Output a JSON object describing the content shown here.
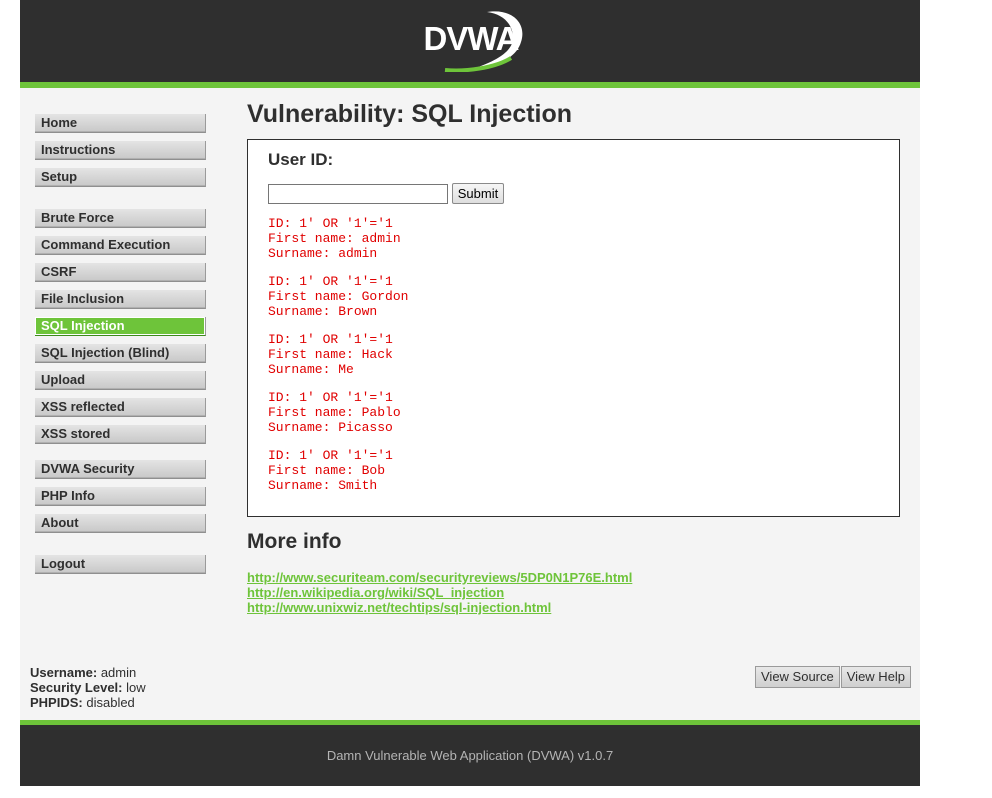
{
  "header": {
    "logo_text": "DVWA"
  },
  "menu": {
    "group1": [
      "Home",
      "Instructions",
      "Setup"
    ],
    "group2": [
      "Brute Force",
      "Command Execution",
      "CSRF",
      "File Inclusion",
      "SQL Injection",
      "SQL Injection (Blind)",
      "Upload",
      "XSS reflected",
      "XSS stored"
    ],
    "group3": [
      "DVWA Security",
      "PHP Info",
      "About"
    ],
    "group4": [
      "Logout"
    ],
    "selected": "SQL Injection"
  },
  "main": {
    "title": "Vulnerability: SQL Injection",
    "form": {
      "label": "User ID:",
      "input_value": "",
      "submit_label": "Submit"
    },
    "results": [
      {
        "id": "ID: 1' OR '1'='1",
        "first": "First name: admin",
        "surname": "Surname: admin"
      },
      {
        "id": "ID: 1' OR '1'='1",
        "first": "First name: Gordon",
        "surname": "Surname: Brown"
      },
      {
        "id": "ID: 1' OR '1'='1",
        "first": "First name: Hack",
        "surname": "Surname: Me"
      },
      {
        "id": "ID: 1' OR '1'='1",
        "first": "First name: Pablo",
        "surname": "Surname: Picasso"
      },
      {
        "id": "ID: 1' OR '1'='1",
        "first": "First name: Bob",
        "surname": "Surname: Smith"
      }
    ],
    "more_info_title": "More info",
    "links": [
      "http://www.securiteam.com/securityreviews/5DP0N1P76E.html",
      "http://en.wikipedia.org/wiki/SQL_injection",
      "http://www.unixwiz.net/techtips/sql-injection.html"
    ]
  },
  "status": {
    "username_label": "Username:",
    "username_value": "admin",
    "security_label": "Security Level:",
    "security_value": "low",
    "phpids_label": "PHPIDS:",
    "phpids_value": "disabled"
  },
  "buttons": {
    "view_source": "View Source",
    "view_help": "View Help"
  },
  "footer": {
    "text": "Damn Vulnerable Web Application (DVWA) v1.0.7"
  },
  "colors": {
    "accent": "#6ec43a",
    "dark": "#2f2f2f",
    "result_text": "#e00000"
  }
}
